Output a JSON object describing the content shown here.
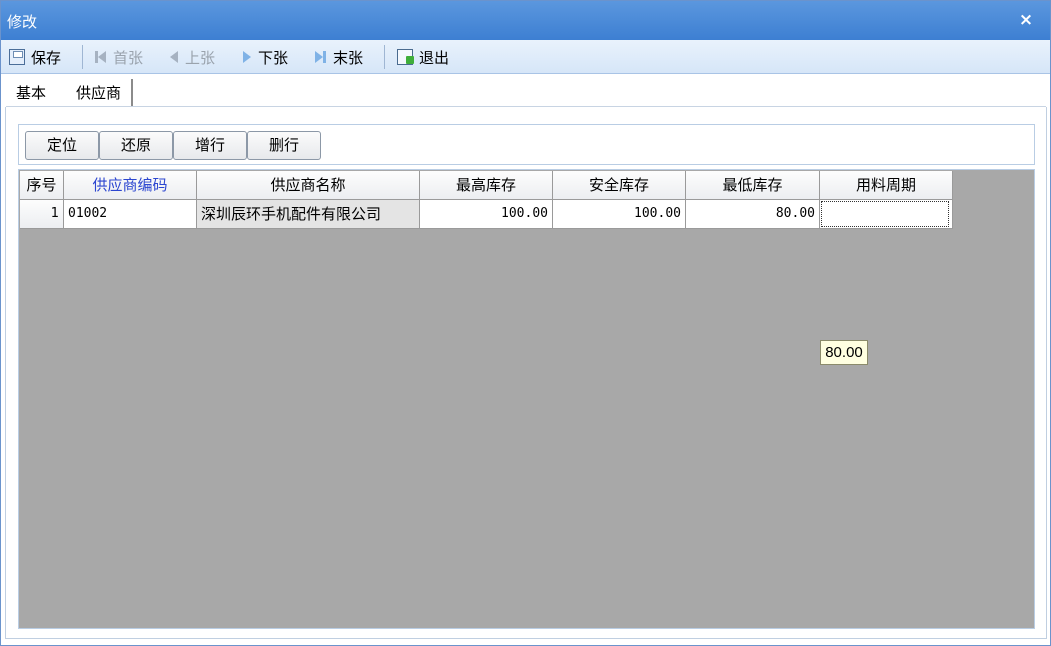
{
  "window": {
    "title": "修改",
    "close_symbol": "×"
  },
  "toolbar": {
    "save_label": "保存",
    "first_label": "首张",
    "prev_label": "上张",
    "next_label": "下张",
    "last_label": "末张",
    "exit_label": "退出",
    "icons": [
      "save-icon",
      "first-record-icon",
      "prev-record-icon",
      "next-record-icon",
      "last-record-icon",
      "exit-icon"
    ]
  },
  "tabs": [
    {
      "label": "基本",
      "active": false
    },
    {
      "label": "供应商",
      "active": true
    }
  ],
  "actions": {
    "locate_label": "定位",
    "restore_label": "还原",
    "add_row_label": "增行",
    "delete_row_label": "删行"
  },
  "grid": {
    "columns": [
      "序号",
      "供应商编码",
      "供应商名称",
      "最高库存",
      "安全库存",
      "最低库存",
      "用料周期"
    ],
    "rows": [
      {
        "seq": "1",
        "supplier_code": "01002",
        "supplier_name": "深圳辰环手机配件有限公司",
        "max_stock": "100.00",
        "safety_stock": "100.00",
        "min_stock": "80.00",
        "lead_cycle": ""
      }
    ]
  },
  "tooltip": {
    "text": "80.00"
  },
  "colors": {
    "titlebar": "#3d7fd2",
    "highlight_header": "#2c46d0",
    "grid_background": "#a8a8a8"
  }
}
